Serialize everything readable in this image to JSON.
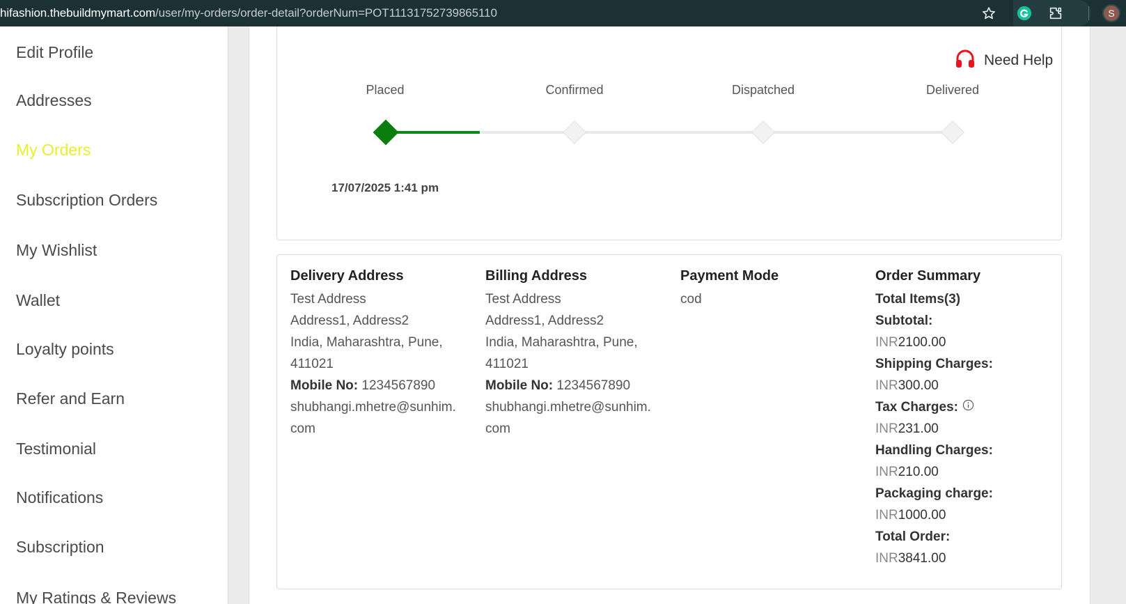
{
  "browser": {
    "url_host": "hifashion.thebuildmymart.com",
    "url_path": "/user/my-orders/order-detail?orderNum=POT11131752739865110",
    "avatar_letter": "S"
  },
  "sidebar": {
    "items": [
      {
        "label": "Edit Profile"
      },
      {
        "label": "Addresses"
      },
      {
        "label": "My Orders",
        "active": true
      },
      {
        "label": "Subscription Orders"
      },
      {
        "label": "My Wishlist"
      },
      {
        "label": "Wallet"
      },
      {
        "label": "Loyalty points"
      },
      {
        "label": "Refer and Earn"
      },
      {
        "label": "Testimonial"
      },
      {
        "label": "Notifications"
      },
      {
        "label": "Subscription"
      },
      {
        "label": "My Ratings & Reviews"
      }
    ],
    "active_color": "#e8ef2e"
  },
  "tracking": {
    "need_help": "Need Help",
    "steps": [
      {
        "label": "Placed",
        "done": true
      },
      {
        "label": "Confirmed",
        "done": false
      },
      {
        "label": "Dispatched",
        "done": false
      },
      {
        "label": "Delivered",
        "done": false
      }
    ],
    "placed_date": "17/07/2025 1:41 pm",
    "progress_color": "#0a8a14"
  },
  "delivery": {
    "title": "Delivery Address",
    "line1": "Test Address",
    "line2": "Address1, Address2",
    "line3": "India, Maharashtra, Pune,",
    "line4": "411021",
    "mobile_label": "Mobile No:",
    "mobile": "1234567890",
    "email1": "shubhangi.mhetre@sunhim.",
    "email2": "com"
  },
  "billing": {
    "title": "Billing Address",
    "line1": "Test Address",
    "line2": "Address1, Address2",
    "line3": "India, Maharashtra, Pune,",
    "line4": "411021",
    "mobile_label": "Mobile No:",
    "mobile": "1234567890",
    "email1": "shubhangi.mhetre@sunhim.",
    "email2": "com"
  },
  "payment": {
    "title": "Payment Mode",
    "mode": "cod"
  },
  "summary": {
    "title": "Order Summary",
    "total_items": "Total Items(3)",
    "currency": "INR",
    "subtotal_label": "Subtotal:",
    "subtotal": "2100.00",
    "shipping_label": "Shipping Charges:",
    "shipping": "300.00",
    "tax_label": "Tax Charges:",
    "tax": "231.00",
    "handling_label": "Handling Charges:",
    "handling": "210.00",
    "packaging_label": "Packaging charge:",
    "packaging": "1000.00",
    "total_label": "Total Order:",
    "total": "3841.00"
  }
}
